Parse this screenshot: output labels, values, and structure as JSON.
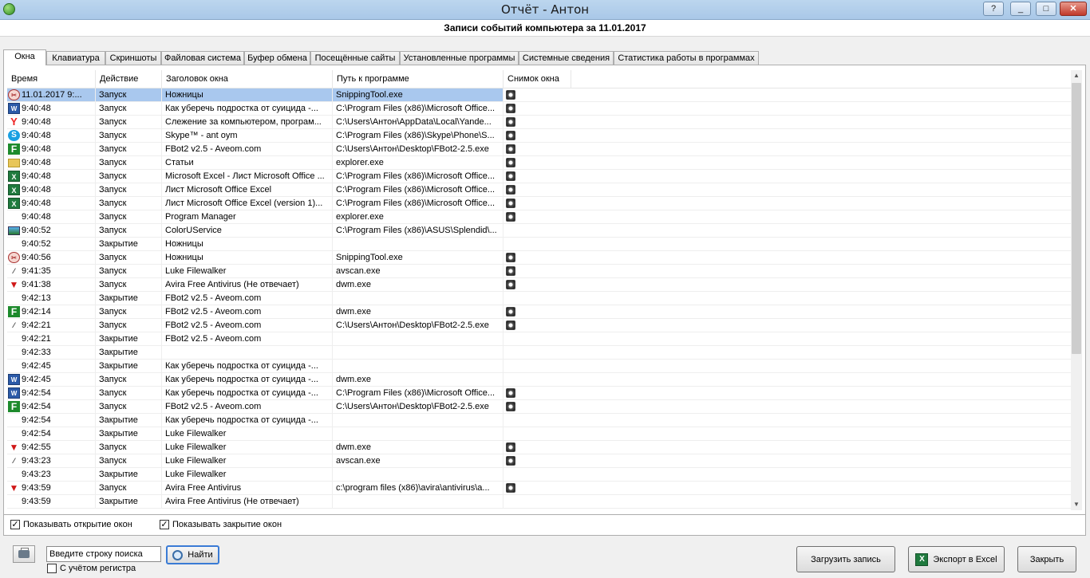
{
  "window": {
    "title": "Отчёт - Антон",
    "help": "?",
    "minimize": "_",
    "maximize": "□",
    "close": "✕"
  },
  "header": {
    "title": "Записи событий компьютера за 11.01.2017"
  },
  "tabs": [
    {
      "label": "Окна",
      "active": true
    },
    {
      "label": "Клавиатура"
    },
    {
      "label": "Скриншоты"
    },
    {
      "label": "Файловая система"
    },
    {
      "label": "Буфер обмена"
    },
    {
      "label": "Посещённые сайты"
    },
    {
      "label": "Установленные программы"
    },
    {
      "label": "Системные сведения"
    },
    {
      "label": "Статистика работы в программах"
    }
  ],
  "columns": {
    "time": "Время",
    "action": "Действие",
    "title": "Заголовок окна",
    "path": "Путь к программе",
    "snapshot": "Снимок окна"
  },
  "rows": [
    {
      "icon": "snipping-icon",
      "time": "11.01.2017 9:...",
      "action": "Запуск",
      "title": "Ножницы",
      "path": "SnippingTool.exe",
      "snap": true,
      "selected": true
    },
    {
      "icon": "word-icon",
      "time": "9:40:48",
      "action": "Запуск",
      "title": "Как уберечь подростка от суицида -...",
      "path": "C:\\Program Files (x86)\\Microsoft Office...",
      "snap": true
    },
    {
      "icon": "yandex-icon",
      "time": "9:40:48",
      "action": "Запуск",
      "title": "Слежение за компьютером, програм...",
      "path": "C:\\Users\\Антон\\AppData\\Local\\Yande...",
      "snap": true
    },
    {
      "icon": "skype-icon",
      "time": "9:40:48",
      "action": "Запуск",
      "title": "Skype™ - ant          oym",
      "path": "C:\\Program Files (x86)\\Skype\\Phone\\S...",
      "snap": true
    },
    {
      "icon": "fbot-icon",
      "time": "9:40:48",
      "action": "Запуск",
      "title": "FBot2 v2.5 - Aveom.com",
      "path": "C:\\Users\\Антон\\Desktop\\FBot2-2.5.exe",
      "snap": true
    },
    {
      "icon": "folder-icon",
      "time": "9:40:48",
      "action": "Запуск",
      "title": "Статьи",
      "path": "explorer.exe",
      "snap": true
    },
    {
      "icon": "excel-icon",
      "time": "9:40:48",
      "action": "Запуск",
      "title": "Microsoft Excel - Лист Microsoft Office ...",
      "path": "C:\\Program Files (x86)\\Microsoft Office...",
      "snap": true
    },
    {
      "icon": "excel-icon",
      "time": "9:40:48",
      "action": "Запуск",
      "title": "Лист Microsoft Office Excel",
      "path": "C:\\Program Files (x86)\\Microsoft Office...",
      "snap": true
    },
    {
      "icon": "excel-icon",
      "time": "9:40:48",
      "action": "Запуск",
      "title": "Лист Microsoft Office Excel (version 1)...",
      "path": "C:\\Program Files (x86)\\Microsoft Office...",
      "snap": true
    },
    {
      "icon": "",
      "time": "9:40:48",
      "action": "Запуск",
      "title": "Program Manager",
      "path": "explorer.exe",
      "snap": true
    },
    {
      "icon": "color-icon",
      "time": "9:40:52",
      "action": "Запуск",
      "title": "ColorUService",
      "path": "C:\\Program Files (x86)\\ASUS\\Splendid\\...",
      "snap": false
    },
    {
      "icon": "",
      "time": "9:40:52",
      "action": "Закрытие",
      "title": "Ножницы",
      "path": "",
      "snap": false
    },
    {
      "icon": "snipping-icon",
      "time": "9:40:56",
      "action": "Запуск",
      "title": "Ножницы",
      "path": "SnippingTool.exe",
      "snap": true
    },
    {
      "icon": "pen-icon",
      "time": "9:41:35",
      "action": "Запуск",
      "title": "Luke Filewalker",
      "path": "avscan.exe",
      "snap": true
    },
    {
      "icon": "avira-icon",
      "time": "9:41:38",
      "action": "Запуск",
      "title": "Avira Free Antivirus (Не отвечает)",
      "path": "dwm.exe",
      "snap": true
    },
    {
      "icon": "",
      "time": "9:42:13",
      "action": "Закрытие",
      "title": "FBot2 v2.5 - Aveom.com",
      "path": "",
      "snap": false
    },
    {
      "icon": "fbot-icon",
      "time": "9:42:14",
      "action": "Запуск",
      "title": "FBot2 v2.5 - Aveom.com",
      "path": "dwm.exe",
      "snap": true
    },
    {
      "icon": "pen-icon",
      "time": "9:42:21",
      "action": "Запуск",
      "title": "FBot2 v2.5 - Aveom.com",
      "path": "C:\\Users\\Антон\\Desktop\\FBot2-2.5.exe",
      "snap": true
    },
    {
      "icon": "",
      "time": "9:42:21",
      "action": "Закрытие",
      "title": "FBot2 v2.5 - Aveom.com",
      "path": "",
      "snap": false
    },
    {
      "icon": "",
      "time": "9:42:33",
      "action": "Закрытие",
      "title": "",
      "path": "",
      "snap": false
    },
    {
      "icon": "",
      "time": "9:42:45",
      "action": "Закрытие",
      "title": "Как уберечь подростка от суицида -...",
      "path": "",
      "snap": false
    },
    {
      "icon": "word-icon",
      "time": "9:42:45",
      "action": "Запуск",
      "title": "Как уберечь подростка от суицида -...",
      "path": "dwm.exe",
      "snap": false
    },
    {
      "icon": "word-icon",
      "time": "9:42:54",
      "action": "Запуск",
      "title": "Как уберечь подростка от суицида -...",
      "path": "C:\\Program Files (x86)\\Microsoft Office...",
      "snap": true
    },
    {
      "icon": "fbot-icon",
      "time": "9:42:54",
      "action": "Запуск",
      "title": "FBot2 v2.5 - Aveom.com",
      "path": "C:\\Users\\Антон\\Desktop\\FBot2-2.5.exe",
      "snap": true
    },
    {
      "icon": "",
      "time": "9:42:54",
      "action": "Закрытие",
      "title": "Как уберечь подростка от суицида -...",
      "path": "",
      "snap": false
    },
    {
      "icon": "",
      "time": "9:42:54",
      "action": "Закрытие",
      "title": "Luke Filewalker",
      "path": "",
      "snap": false
    },
    {
      "icon": "avira-icon",
      "time": "9:42:55",
      "action": "Запуск",
      "title": "Luke Filewalker",
      "path": "dwm.exe",
      "snap": true
    },
    {
      "icon": "pen-icon",
      "time": "9:43:23",
      "action": "Запуск",
      "title": "Luke Filewalker",
      "path": "avscan.exe",
      "snap": true
    },
    {
      "icon": "",
      "time": "9:43:23",
      "action": "Закрытие",
      "title": "Luke Filewalker",
      "path": "",
      "snap": false
    },
    {
      "icon": "avira-icon",
      "time": "9:43:59",
      "action": "Запуск",
      "title": "Avira Free Antivirus",
      "path": "c:\\program files (x86)\\avira\\antivirus\\a...",
      "snap": true
    },
    {
      "icon": "",
      "time": "9:43:59",
      "action": "Закрытие",
      "title": "Avira Free Antivirus (Не отвечает)",
      "path": "",
      "snap": false
    }
  ],
  "options": {
    "show_open": "Показывать открытие окон",
    "show_close": "Показывать закрытие окон",
    "show_open_checked": true,
    "show_close_checked": true
  },
  "search": {
    "value": "Введите строку поиска",
    "find_label": "Найти",
    "case_label": "С учётом регистра",
    "case_checked": false
  },
  "buttons": {
    "load": "Загрузить запись",
    "export": "Экспорт в Excel",
    "close": "Закрыть"
  }
}
